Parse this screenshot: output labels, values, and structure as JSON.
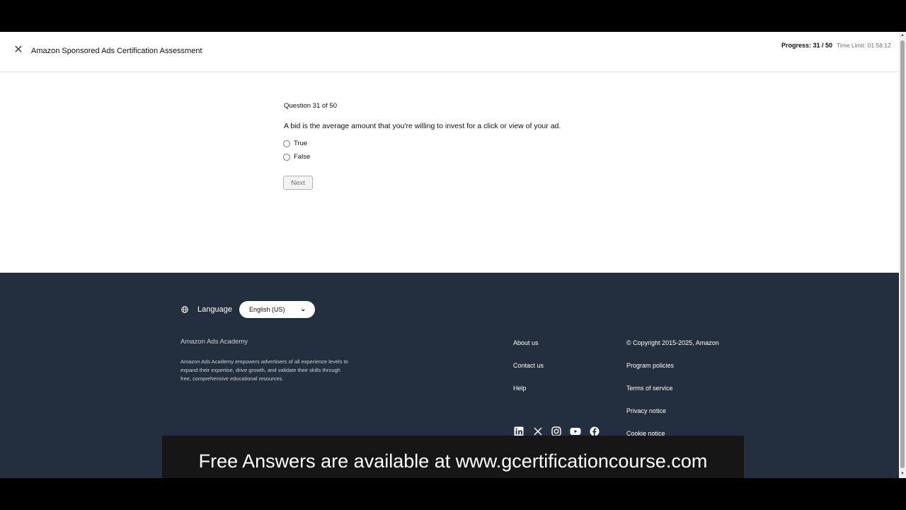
{
  "header": {
    "close_glyph": "✕",
    "title": "Amazon Sponsored Ads Certification Assessment",
    "progress": "Progress: 31 / 50",
    "time_limit": "Time Limit: 01:58:12"
  },
  "question": {
    "counter": "Question 31 of 50",
    "text": "A bid is the average amount that you're willing to invest for a click or view of your ad.",
    "options": [
      {
        "label": "True"
      },
      {
        "label": "False"
      }
    ],
    "next_label": "Next"
  },
  "footer": {
    "language_label": "Language",
    "language_selected": "English (US)",
    "academy_title": "Amazon Ads Academy",
    "academy_description": "Amazon Ads Academy empowers advertisers of all experience levels to expand their expertise, drive growth, and validate their skills through free, comprehensive educational resources.",
    "links_col1": [
      "About us",
      "Contact us",
      "Help"
    ],
    "copyright": "© Copyright 2015-2025, Amazon",
    "links_col2": [
      "Program policies",
      "Terms of service",
      "Privacy notice",
      "Cookie notice"
    ],
    "social_icons": [
      "linkedin-icon",
      "x-icon",
      "instagram-icon",
      "youtube-icon",
      "facebook-icon"
    ]
  },
  "overlay": {
    "banner_text": "Free Answers are available at www.gcertificationcourse.com"
  },
  "colors": {
    "footer_bg": "#232f3e",
    "text_primary": "#0f1111",
    "banner_bg": "#161616"
  }
}
